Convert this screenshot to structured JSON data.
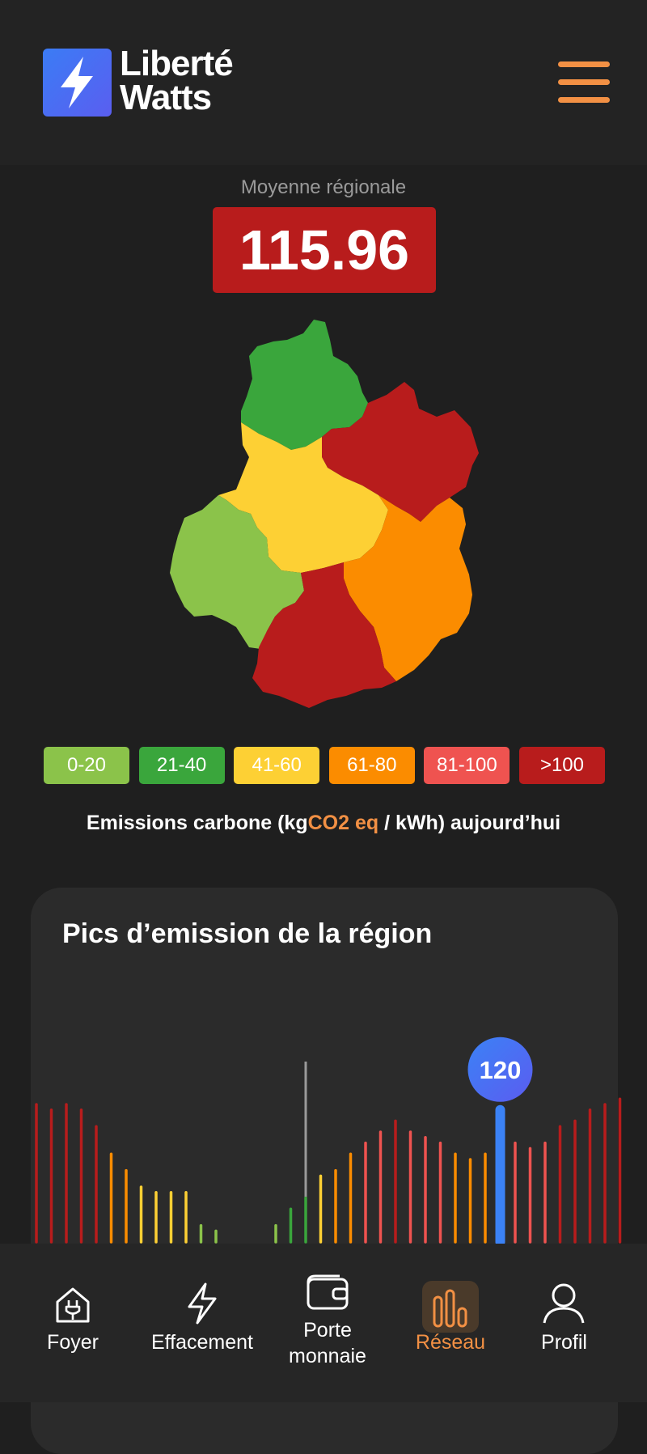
{
  "app": {
    "brand_line1": "Liberté",
    "brand_line2": "Watts",
    "logo_icon": "lightning-bolt-icon",
    "menu_icon": "hamburger-menu-icon"
  },
  "regional_average": {
    "label": "Moyenne régionale",
    "value": "115.96",
    "color": "#b81c1c"
  },
  "map": {
    "regions": [
      {
        "name": "",
        "level": "21-40",
        "color": "#3aa63c"
      },
      {
        "name": "",
        "level": ">100",
        "color": "#b81c1c"
      },
      {
        "name": "",
        "level": "41-60",
        "color": "#fdd034"
      },
      {
        "name": "",
        "level": "0-20",
        "color": "#8bc34a"
      },
      {
        "name": "",
        "level": "61-80",
        "color": "#fb8c00"
      },
      {
        "name": "",
        "level": ">100",
        "color": "#b81c1c"
      }
    ]
  },
  "legend": [
    {
      "label": "0-20",
      "color": "#8bc34a"
    },
    {
      "label": "21-40",
      "color": "#3aa63c"
    },
    {
      "label": "41-60",
      "color": "#fdd034"
    },
    {
      "label": "61-80",
      "color": "#fb8c00"
    },
    {
      "label": "81-100",
      "color": "#ef5350"
    },
    {
      "label": ">100",
      "color": "#b81c1c"
    }
  ],
  "caption": {
    "part1": "Emissions carbone (kg",
    "highlight": "CO2 eq",
    "part2": " / kWh) aujourd’hui",
    "highlight_color": "#f29044"
  },
  "peaks_card": {
    "title": "Pics d’emission de la région",
    "selected_value": "120",
    "selected_color": "#3b82f6"
  },
  "chart_data": {
    "type": "bar",
    "title": "Pics d’emission de la région",
    "values": [
      125,
      120,
      125,
      120,
      105,
      80,
      65,
      50,
      45,
      45,
      45,
      15,
      10,
      0,
      0,
      0,
      15,
      30,
      40,
      60,
      65,
      80,
      90,
      100,
      110,
      100,
      95,
      90,
      80,
      75,
      80,
      120,
      90,
      85,
      90,
      105,
      110,
      120,
      125,
      130
    ],
    "highlight_index": 31,
    "highlight_label": "120",
    "marker_index": 18,
    "ylim": [
      0,
      140
    ]
  },
  "nav": {
    "items": [
      {
        "label": "Foyer",
        "icon": "house-plug-icon"
      },
      {
        "label": "Effacement",
        "icon": "lightning-icon"
      },
      {
        "label": "Porte",
        "label2": "monnaie",
        "icon": "wallet-icon"
      },
      {
        "label": "Réseau",
        "icon": "bar-chart-icon",
        "active": true
      },
      {
        "label": "Profil",
        "icon": "user-icon"
      }
    ],
    "active_color": "#f29044"
  }
}
